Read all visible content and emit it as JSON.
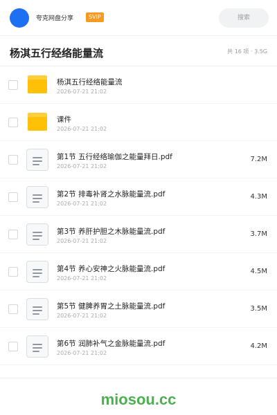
{
  "topbar": {
    "app_name": "夸克网盘分享",
    "badge": "SVIP",
    "search_placeholder": "搜索"
  },
  "folder": {
    "title": "杨淇五行经络能量流",
    "meta": "共 16 项 · 3.5G"
  },
  "items": [
    {
      "type": "folder",
      "name": "杨淇五行经络能量流",
      "date": "2026-07-21 21:02",
      "size": ""
    },
    {
      "type": "folder",
      "name": "课件",
      "date": "2026-07-21 21:02",
      "size": ""
    },
    {
      "type": "file",
      "name": "第1节 五行经络瑜伽之能量拜日.pdf",
      "date": "2026-07-21 21:02",
      "size": "7.2M"
    },
    {
      "type": "file",
      "name": "第2节 排毒补肾之水脉能量流.pdf",
      "date": "2026-07-21 21:02",
      "size": "4.3M"
    },
    {
      "type": "file",
      "name": "第3节 养肝护胆之木脉能量流.pdf",
      "date": "2026-07-21 21:02",
      "size": "3.7M"
    },
    {
      "type": "file",
      "name": "第4节 养心安神之火脉能量流.pdf",
      "date": "2026-07-21 21:02",
      "size": "4.5M"
    },
    {
      "type": "file",
      "name": "第5节 健脾养胃之土脉能量流.pdf",
      "date": "2026-07-21 21:02",
      "size": "3.5M"
    },
    {
      "type": "file",
      "name": "第6节 润肺补气之金脉能量流.pdf",
      "date": "2026-07-21 21:02",
      "size": "4.2M"
    }
  ],
  "footer": {
    "watermark": "miosou.cc"
  },
  "colors": {
    "accent": "#1f6ff2",
    "badge": "#f59a23",
    "folder": "#ffc107",
    "watermark": "#4caf50"
  }
}
